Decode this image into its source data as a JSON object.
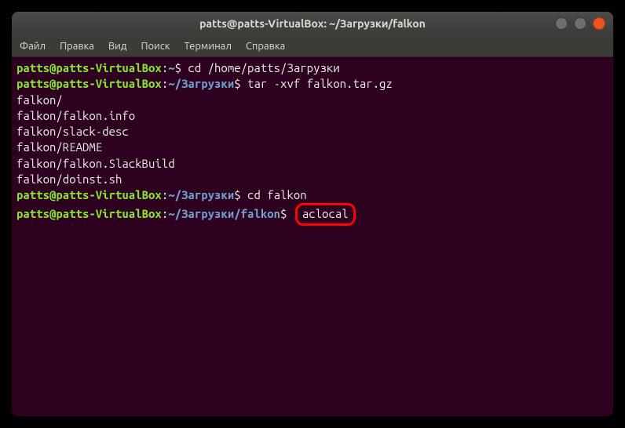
{
  "window": {
    "title": "patts@patts-VirtualBox: ~/Загрузки/falkon"
  },
  "menubar": {
    "items": [
      "Файл",
      "Правка",
      "Вид",
      "Поиск",
      "Терминал",
      "Справка"
    ]
  },
  "terminal": {
    "lines": [
      {
        "type": "prompt",
        "user": "patts@patts-VirtualBox",
        "sep1": ":",
        "path": "~",
        "sep2": "$",
        "cmd": " cd /home/patts/Загрузки"
      },
      {
        "type": "prompt",
        "user": "patts@patts-VirtualBox",
        "sep1": ":",
        "path": "~/Загрузки",
        "sep2": "$",
        "cmd": " tar -xvf falkon.tar.gz"
      },
      {
        "type": "output",
        "text": "falkon/"
      },
      {
        "type": "output",
        "text": "falkon/falkon.info"
      },
      {
        "type": "output",
        "text": "falkon/slack-desc"
      },
      {
        "type": "output",
        "text": "falkon/README"
      },
      {
        "type": "output",
        "text": "falkon/falkon.SlackBuild"
      },
      {
        "type": "output",
        "text": "falkon/doinst.sh"
      },
      {
        "type": "prompt",
        "user": "patts@patts-VirtualBox",
        "sep1": ":",
        "path": "~/Загрузки",
        "sep2": "$",
        "cmd": " cd falkon"
      },
      {
        "type": "prompt_highlight",
        "user": "patts@patts-VirtualBox",
        "sep1": ":",
        "path": "~/Загрузки/falkon",
        "sep2": "$",
        "highlight": "aclocal"
      }
    ]
  }
}
